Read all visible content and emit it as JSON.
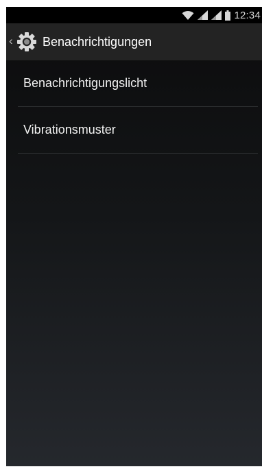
{
  "status_bar": {
    "time": "12:34",
    "icons": [
      "wifi-icon",
      "signal-icon",
      "signal-icon",
      "battery-icon"
    ]
  },
  "action_bar": {
    "back_icon": "chevron-left-icon",
    "app_icon": "gear-icon",
    "title": "Benachrichtigungen"
  },
  "settings": {
    "items": [
      {
        "label": "Benachrichtigungslicht"
      },
      {
        "label": "Vibrationsmuster"
      }
    ]
  },
  "colors": {
    "status_bar_bg": "#000000",
    "action_bar_bg": "#232323",
    "text": "#f2f2f2",
    "divider": "#2f3133"
  }
}
